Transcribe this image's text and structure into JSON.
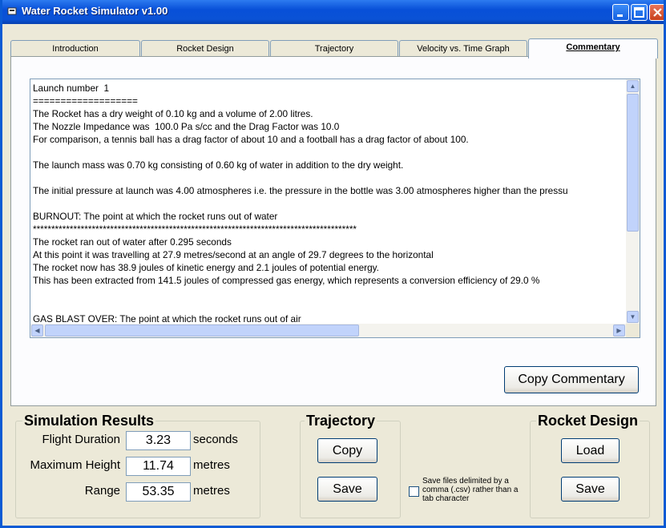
{
  "window": {
    "title": "Water Rocket Simulator v1.00"
  },
  "tabs": [
    {
      "label": "Introduction"
    },
    {
      "label": "Rocket Design"
    },
    {
      "label": "Trajectory"
    },
    {
      "label": "Velocity vs. Time Graph"
    },
    {
      "label": "Commentary"
    }
  ],
  "commentary": {
    "lines": [
      "Launch number  1",
      "===================",
      "The Rocket has a dry weight of 0.10 kg and a volume of 2.00 litres.",
      "The Nozzle Impedance was  100.0 Pa s/cc and the Drag Factor was 10.0",
      "For comparison, a tennis ball has a drag factor of about 10 and a football has a drag factor of about 100.",
      "",
      "The launch mass was 0.70 kg consisting of 0.60 kg of water in addition to the dry weight.",
      "",
      "The initial pressure at launch was 4.00 atmospheres i.e. the pressure in the bottle was 3.00 atmospheres higher than the pressu",
      "",
      "BURNOUT: The point at which the rocket runs out of water",
      "****************************************************************************************",
      "The rocket ran out of water after 0.295 seconds",
      "At this point it was travelling at 27.9 metres/second at an angle of 29.7 degrees to the horizontal",
      "The rocket now has 38.9 joules of kinetic energy and 2.1 joules of potential energy.",
      "This has been extracted from 141.5 joules of compressed gas energy, which represents a conversion efficiency of 29.0 %",
      "",
      "",
      "GAS BLAST OVER: The point at which the rocket runs out of air",
      "****************************************************************************************"
    ],
    "copy_button": "Copy Commentary"
  },
  "simulation_results": {
    "title": "Simulation Results",
    "flight_duration": {
      "label": "Flight Duration",
      "value": "3.23",
      "unit": "seconds"
    },
    "maximum_height": {
      "label": "Maximum Height",
      "value": "11.74",
      "unit": "metres"
    },
    "range": {
      "label": "Range",
      "value": "53.35",
      "unit": "metres"
    }
  },
  "trajectory": {
    "title": "Trajectory",
    "copy_button": "Copy",
    "save_button": "Save"
  },
  "csv_option": {
    "label": "Save files delimited by a comma (.csv) rather than a tab character",
    "checked": false
  },
  "rocket_design": {
    "title": "Rocket Design",
    "load_button": "Load",
    "save_button": "Save"
  },
  "colors": {
    "titlebar": "#0a52d6",
    "window_bg": "#ece9d8",
    "panel_bg": "#fcfcfe"
  }
}
